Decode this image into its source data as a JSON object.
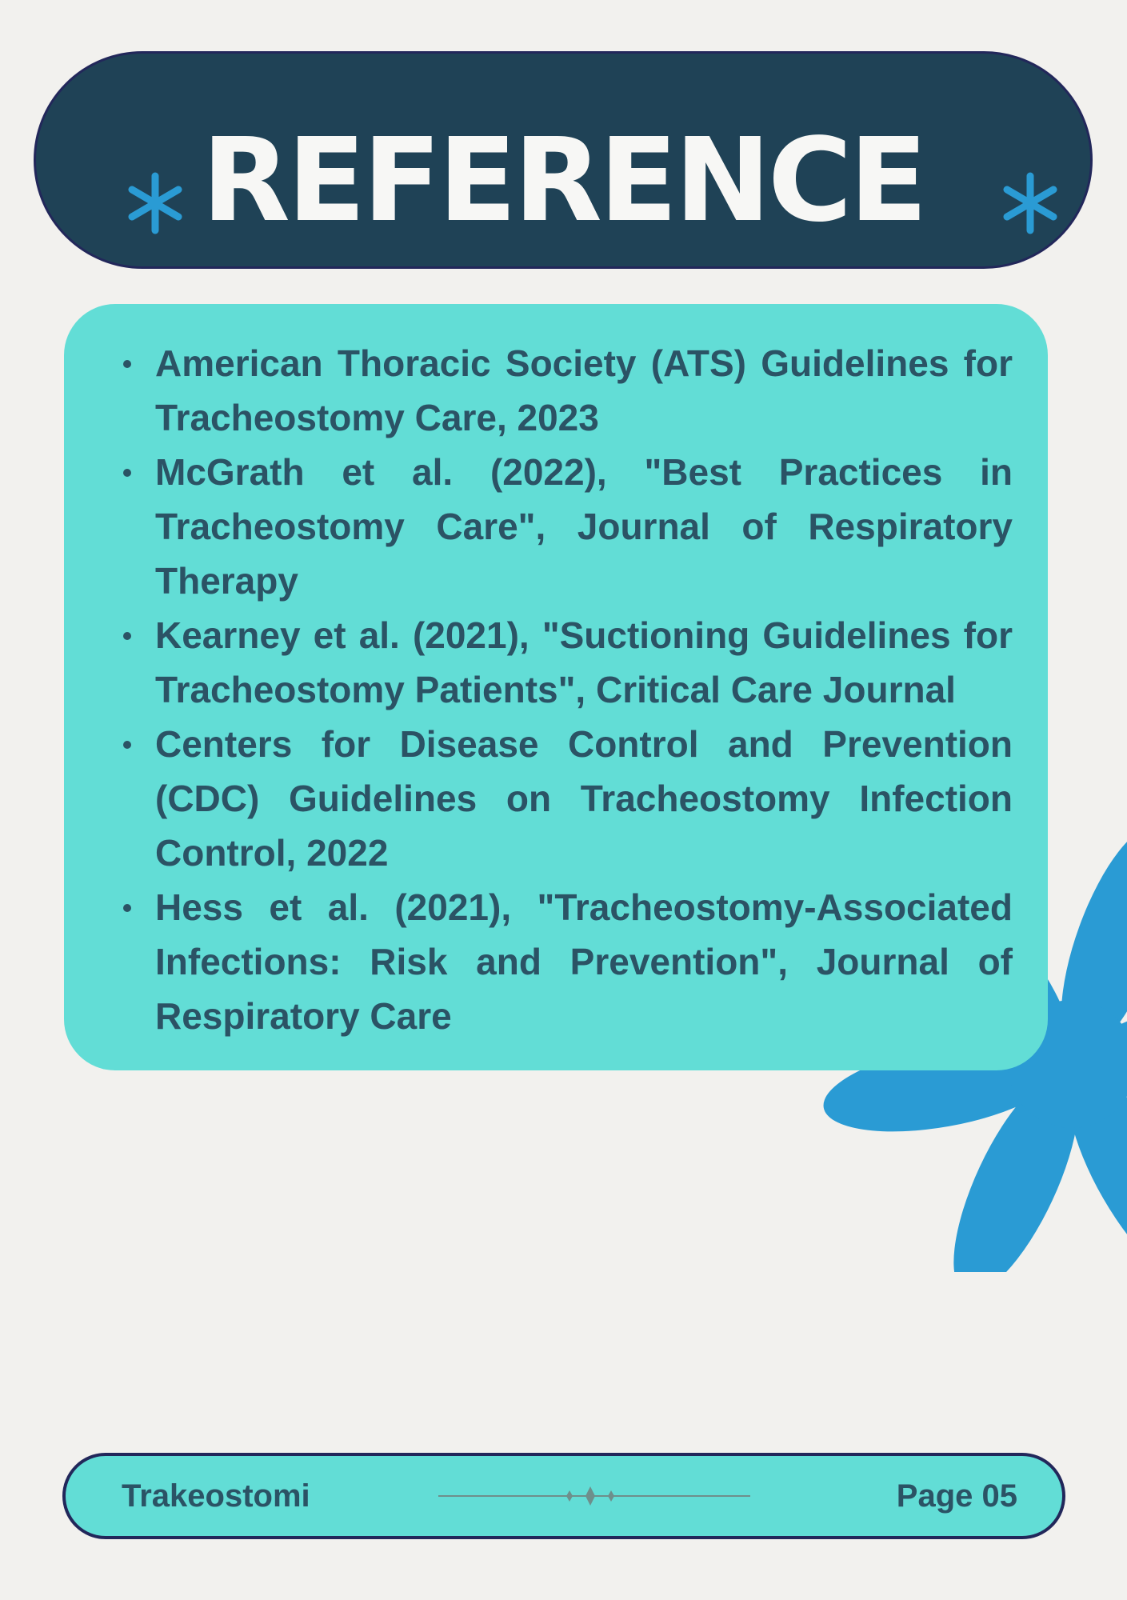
{
  "header": {
    "title": "REFERENCE",
    "star_icon": "asterisk-icon",
    "star_color": "#2a9bd4",
    "background": "#1f4256"
  },
  "references": {
    "items": [
      "American Thoracic Society (ATS) Guidelines for Tracheostomy Care, 2023",
      "McGrath et al. (2022), \"Best Practices in Tracheostomy Care\", Journal of Respiratory Therapy",
      "Kearney et al. (2021), \"Suctioning Guidelines for Tracheostomy Patients\", Critical Care Journal",
      "Centers for Disease Control and Prevention (CDC) Guidelines on Tracheostomy Infection Control, 2022",
      "Hess et al. (2021), \"Tracheostomy-Associated Infections: Risk and Prevention\", Journal of Respiratory Care"
    ],
    "card_color": "#62ddd6",
    "text_color": "#2b5365"
  },
  "decoration": {
    "flower_icon": "flower-icon",
    "flower_color": "#2a9bd4"
  },
  "footer": {
    "left_text": "Trakeostomi",
    "right_text": "Page 05",
    "ornament_icon": "sparkle-divider-icon"
  }
}
